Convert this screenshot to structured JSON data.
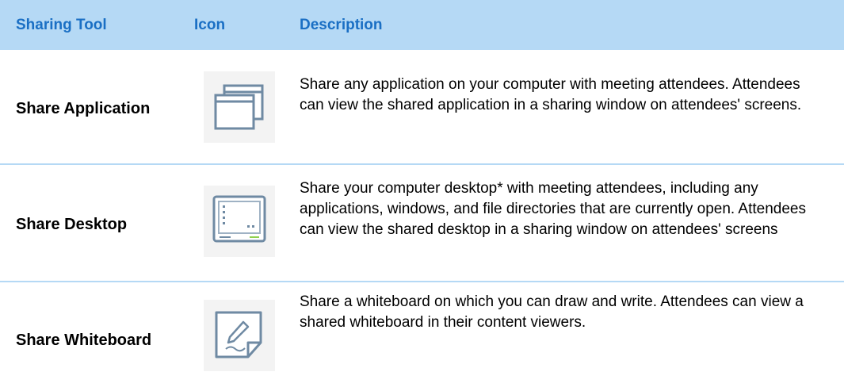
{
  "header": {
    "col_tool": "Sharing Tool",
    "col_icon": "Icon",
    "col_desc": "Description"
  },
  "rows": [
    {
      "tool": "Share Application",
      "icon": "application-windows-icon",
      "description": "Share any application on your computer with meeting attendees. Attendees can view the shared application in a sharing window on attendees' screens."
    },
    {
      "tool": "Share Desktop",
      "icon": "desktop-monitor-icon",
      "description": "Share your computer desktop* with meeting attendees, including any applications, windows, and file directories that are currently open. Attendees can view the shared desktop in a sharing window on attendees' screens"
    },
    {
      "tool": "Share Whiteboard",
      "icon": "whiteboard-pencil-icon",
      "description": "Share a whiteboard on which you can draw and write. Attendees can view a shared whiteboard in their content viewers."
    }
  ],
  "colors": {
    "header_bg": "#b5d9f5",
    "header_text": "#1a6fc4",
    "divider": "#b5d9f5",
    "icon_stroke": "#6f8aa3"
  }
}
